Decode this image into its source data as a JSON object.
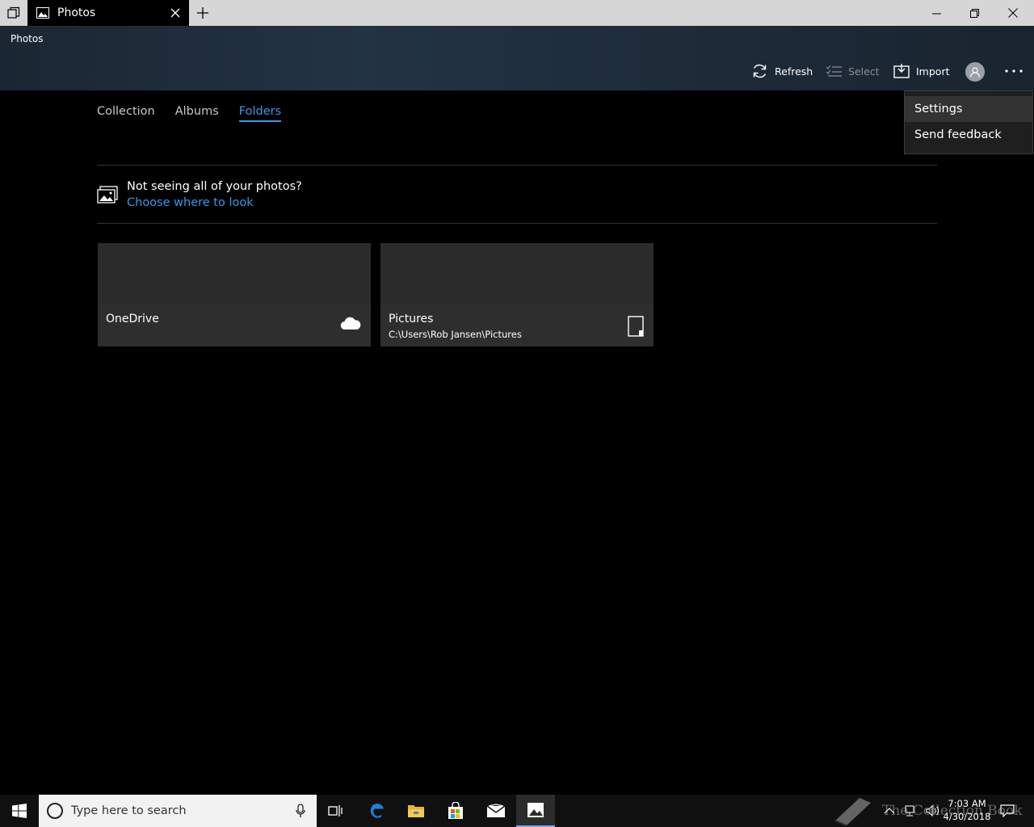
{
  "window": {
    "tab_title": "Photos",
    "app_title": "Photos"
  },
  "toolbar": {
    "refresh": "Refresh",
    "select": "Select",
    "import": "Import"
  },
  "menu": {
    "items": [
      "Settings",
      "Send feedback"
    ]
  },
  "nav": {
    "tabs": [
      "Collection",
      "Albums",
      "Folders"
    ],
    "active": "Folders"
  },
  "notice": {
    "title": "Not seeing all of your photos?",
    "link": "Choose where to look"
  },
  "folders": [
    {
      "name": "OneDrive",
      "path": "",
      "icon": "cloud-icon"
    },
    {
      "name": "Pictures",
      "path": "C:\\Users\\Rob Jansen\\Pictures",
      "icon": "device-icon"
    }
  ],
  "taskbar": {
    "search_placeholder": "Type here to search",
    "time": "7:03 AM",
    "date": "4/30/2018",
    "watermark": "The Collection Book"
  },
  "colors": {
    "accent": "#3a97ea",
    "header": "#1f2d3b"
  }
}
